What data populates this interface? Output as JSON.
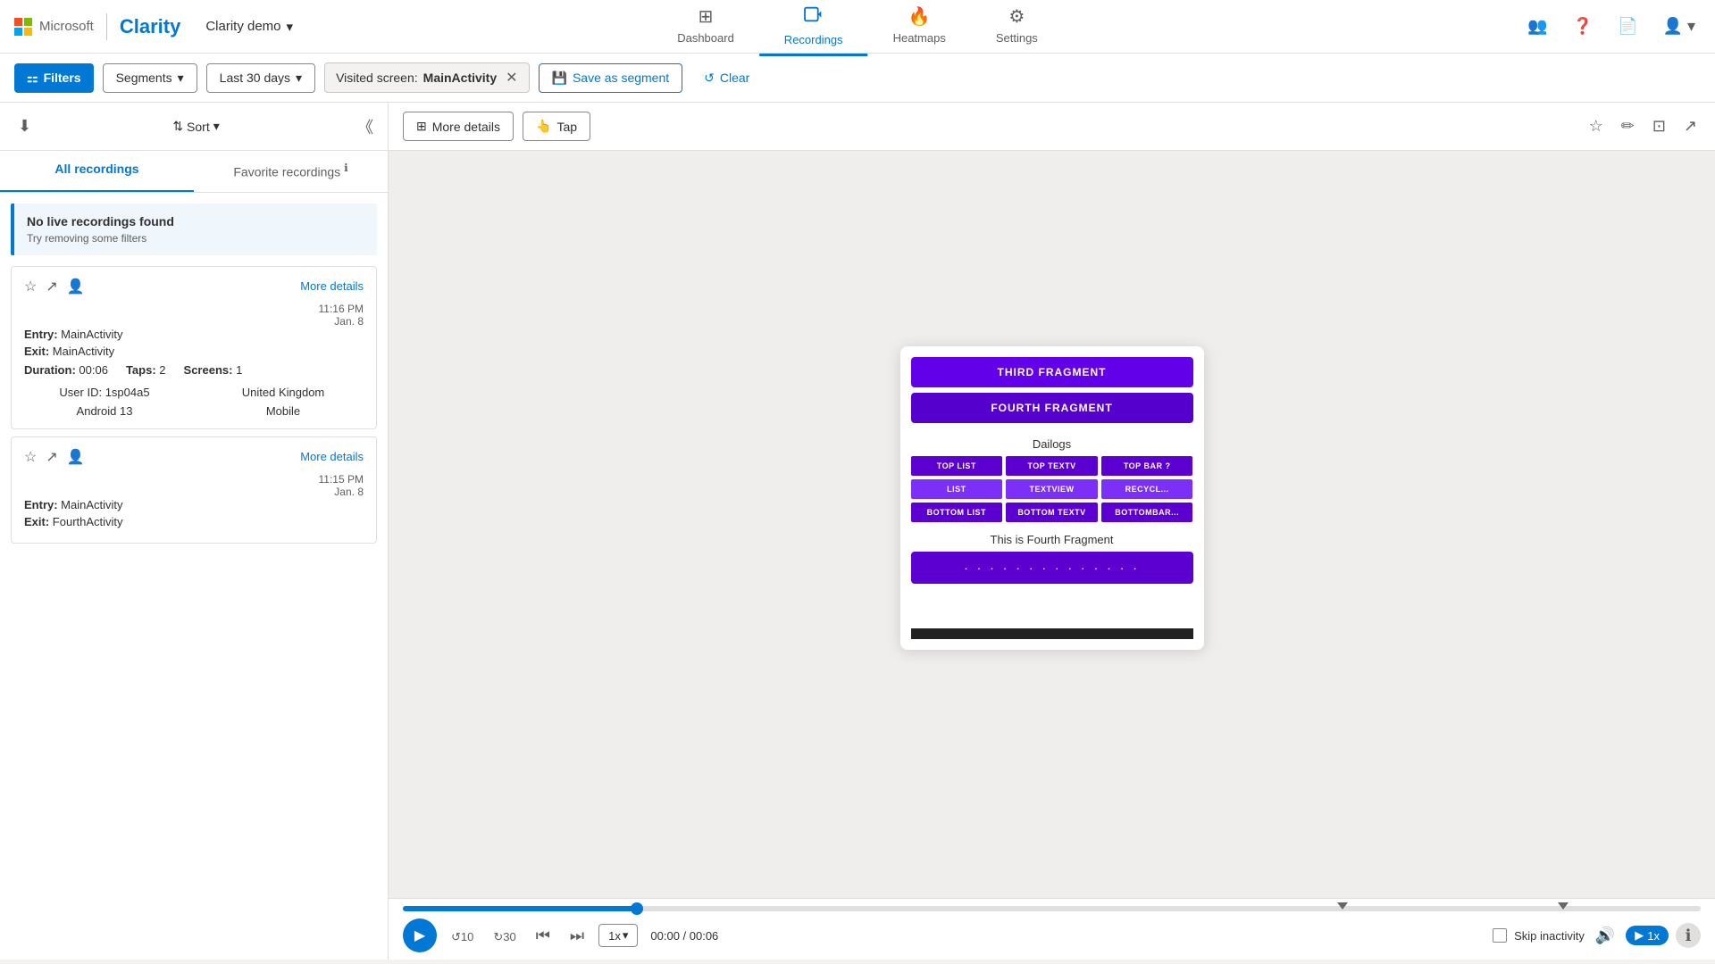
{
  "brand": {
    "ms_label": "Microsoft",
    "clarity_label": "Clarity"
  },
  "project": {
    "name": "Clarity demo",
    "dropdown_icon": "▾"
  },
  "nav": {
    "items": [
      {
        "id": "dashboard",
        "label": "Dashboard",
        "icon": "⊞",
        "active": false
      },
      {
        "id": "recordings",
        "label": "Recordings",
        "icon": "📹",
        "active": true
      },
      {
        "id": "heatmaps",
        "label": "Heatmaps",
        "icon": "🔥",
        "active": false
      },
      {
        "id": "settings",
        "label": "Settings",
        "icon": "⚙",
        "active": false
      }
    ]
  },
  "filter_bar": {
    "filters_label": "Filters",
    "segments_label": "Segments",
    "segments_dropdown": "▾",
    "date_label": "Last 30 days",
    "date_dropdown": "▾",
    "visited_screen_label": "Visited screen:",
    "visited_screen_value": "MainActivity",
    "save_segment_label": "Save as segment",
    "clear_label": "Clear"
  },
  "left_panel": {
    "sort_label": "Sort",
    "tabs": [
      {
        "id": "all",
        "label": "All recordings",
        "active": true
      },
      {
        "id": "favorite",
        "label": "Favorite recordings",
        "active": false
      }
    ],
    "no_recordings": {
      "title": "No live recordings found",
      "subtitle": "Try removing some filters"
    },
    "recordings": [
      {
        "id": "rec1",
        "entry": "MainActivity",
        "exit": "MainActivity",
        "duration": "00:06",
        "taps": "2",
        "screens": "1",
        "user_id": "1sp04a5",
        "country": "United Kingdom",
        "os": "Android 13",
        "device": "Mobile",
        "timestamp": "11:16 PM",
        "date": "Jan. 8",
        "more_details": "More details"
      },
      {
        "id": "rec2",
        "entry": "MainActivity",
        "exit": "FourthActivity",
        "duration": "",
        "taps": "",
        "screens": "",
        "user_id": "",
        "country": "",
        "os": "",
        "device": "",
        "timestamp": "11:15 PM",
        "date": "Jan. 8",
        "more_details": "More details"
      }
    ]
  },
  "right_panel": {
    "more_details_label": "More details",
    "tap_label": "Tap",
    "phone_content": {
      "third_fragment": "THIRD FRAGMENT",
      "fourth_fragment": "FOURTH FRAGMENT",
      "dialogs_label": "Dailogs",
      "dialog_buttons": [
        "TOP LIST",
        "TOP TEXTV",
        "TOP BAR ?",
        "LIST",
        "TEXTVIEW",
        "RECYCL...",
        "BOTTOM LIST",
        "BOTTOM TEXTV",
        "BOTTOMBAR..."
      ],
      "fourth_fragment_label": "This is Fourth Fragment",
      "progress_dots": "· · · · · · · · · · · · · ·"
    },
    "playback": {
      "progress_percent": 18,
      "thumb_percent": 18,
      "marker1_percent": 72,
      "marker2_percent": 89,
      "speed": "1x",
      "time_current": "00:00",
      "time_total": "00:06",
      "time_display": "00:00 / 00:06",
      "skip_inactivity": "Skip inactivity"
    }
  }
}
